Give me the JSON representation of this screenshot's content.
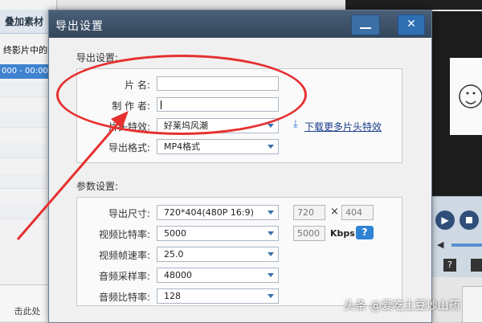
{
  "background": {
    "left_tab_label": "叠加素材",
    "hint_text": "终影片中的时",
    "selected_row_text": "000 - 00:00",
    "bottom_text": "击此处"
  },
  "dialog": {
    "title": "导出设置",
    "close_label": "✕",
    "export_section": {
      "title": "导出设置:",
      "name_label": "片    名:",
      "name_value": "",
      "author_label": "制 作 者:",
      "author_value": "",
      "intro_effect_label": "片头特效:",
      "intro_effect_value": "好莱坞风潮",
      "download_link": "下载更多片头特效",
      "format_label": "导出格式:",
      "format_value": "MP4格式"
    },
    "params_section": {
      "title": "参数设置:",
      "size_label": "导出尺寸:",
      "size_value": "720*404(480P 16:9)",
      "width_value": "720",
      "times_sign": "×",
      "height_value": "404",
      "bitrate_label": "视频比特率:",
      "bitrate_value": "5000",
      "bitrate_custom": "5000",
      "bitrate_unit": "Kbps",
      "help_label": "?",
      "framerate_label": "视频帧速率:",
      "framerate_value": "25.0",
      "samplerate_label": "音频采样率:",
      "samplerate_value": "48000",
      "audiobitrate_label": "音频比特率:",
      "audiobitrate_value": "128"
    }
  },
  "watermark": "头条 @爱吃土豆炒山药",
  "colors": {
    "accent_red": "#e63030",
    "title_bar": "#3d5269",
    "link_blue": "#1a3e8c"
  }
}
